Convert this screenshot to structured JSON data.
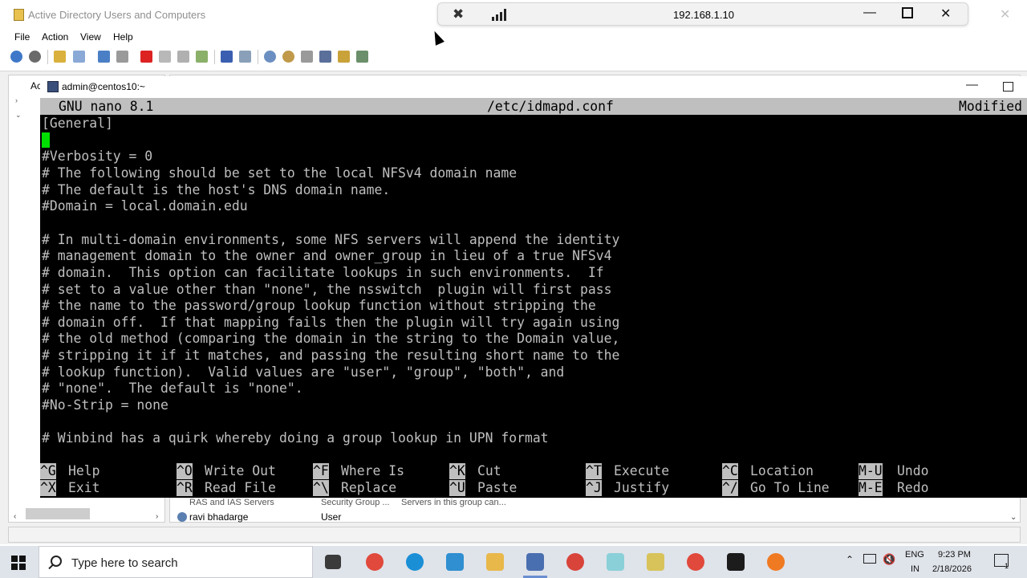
{
  "ad_window": {
    "title": "Active Directory Users and Computers",
    "menu": [
      "File",
      "Action",
      "View",
      "Help"
    ],
    "tree_label": "Ac",
    "rows": [
      {
        "name": "RAS and IAS Servers",
        "type": "Security Group ...",
        "description": "Servers in this group can..."
      },
      {
        "name": "ravi bhadarge",
        "type": "User",
        "description": ""
      }
    ]
  },
  "rdp_bar": {
    "host": "192.168.1.10"
  },
  "putty": {
    "title": "admin@centos10:~"
  },
  "nano": {
    "version": "GNU nano 8.1",
    "filename": "/etc/idmapd.conf",
    "status": "Modified",
    "lines": [
      "[General]",
      "",
      "#Verbosity = 0",
      "# The following should be set to the local NFSv4 domain name",
      "# The default is the host's DNS domain name.",
      "#Domain = local.domain.edu",
      "",
      "# In multi-domain environments, some NFS servers will append the identity",
      "# management domain to the owner and owner_group in lieu of a true NFSv4",
      "# domain.  This option can facilitate lookups in such environments.  If",
      "# set to a value other than \"none\", the nsswitch  plugin will first pass",
      "# the name to the password/group lookup function without stripping the",
      "# domain off.  If that mapping fails then the plugin will try again using",
      "# the old method (comparing the domain in the string to the Domain value,",
      "# stripping it if it matches, and passing the resulting short name to the",
      "# lookup function).  Valid values are \"user\", \"group\", \"both\", and",
      "# \"none\".  The default is \"none\".",
      "#No-Strip = none",
      "",
      "# Winbind has a quirk whereby doing a group lookup in UPN format"
    ],
    "shortcuts_row1": [
      {
        "key": "^G",
        "label": "Help"
      },
      {
        "key": "^O",
        "label": "Write Out"
      },
      {
        "key": "^F",
        "label": "Where Is"
      },
      {
        "key": "^K",
        "label": "Cut"
      },
      {
        "key": "^T",
        "label": "Execute"
      },
      {
        "key": "^C",
        "label": "Location"
      },
      {
        "key": "M-U",
        "label": "Undo"
      }
    ],
    "shortcuts_row2": [
      {
        "key": "^X",
        "label": "Exit"
      },
      {
        "key": "^R",
        "label": "Read File"
      },
      {
        "key": "^\\",
        "label": "Replace"
      },
      {
        "key": "^U",
        "label": "Paste"
      },
      {
        "key": "^J",
        "label": "Justify"
      },
      {
        "key": "^/",
        "label": "Go To Line"
      },
      {
        "key": "M-E",
        "label": "Redo"
      }
    ]
  },
  "taskbar": {
    "search_placeholder": "Type here to search",
    "language": "ENG",
    "region": "IN",
    "time": "9:23 PM",
    "date": "2/18/2026",
    "notification_count": "1"
  },
  "colors": {
    "terminal_bg": "#000000",
    "terminal_fg": "#bfbfbf",
    "nano_header_bg": "#bfbfbf",
    "cursor": "#00e000"
  }
}
